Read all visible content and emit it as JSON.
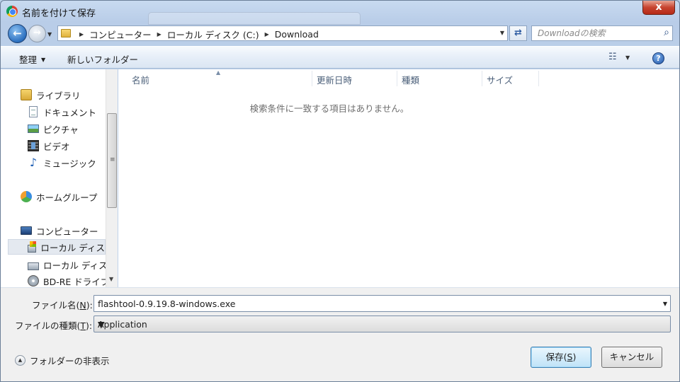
{
  "window": {
    "title": "名前を付けて保存",
    "close_label": "x"
  },
  "nav": {
    "back_label": "←",
    "forward_label": "→"
  },
  "address": {
    "crumbs": [
      "コンピューター",
      "ローカル ディスク (C:)",
      "Download"
    ]
  },
  "search": {
    "placeholder": "Downloadの検索"
  },
  "toolbar": {
    "organize_label": "整理",
    "new_folder_label": "新しいフォルダー",
    "help_label": "?"
  },
  "sidebar": {
    "items": [
      {
        "label": "ライブラリ",
        "icon": "library-icon"
      },
      {
        "label": "ドキュメント",
        "icon": "documents-icon"
      },
      {
        "label": "ピクチャ",
        "icon": "pictures-icon"
      },
      {
        "label": "ビデオ",
        "icon": "videos-icon"
      },
      {
        "label": "ミュージック",
        "icon": "music-icon"
      },
      {
        "label": "ホームグループ",
        "icon": "homegroup-icon"
      },
      {
        "label": "コンピューター",
        "icon": "computer-icon"
      },
      {
        "label": "ローカル ディス",
        "icon": "local-disk-icon",
        "selected": true
      },
      {
        "label": "ローカル ディス",
        "icon": "local-disk-icon"
      },
      {
        "label": "BD-RE ドライブ",
        "icon": "bd-drive-icon"
      }
    ]
  },
  "file_list": {
    "columns": [
      "名前",
      "更新日時",
      "種類",
      "サイズ"
    ],
    "empty_message": "検索条件に一致する項目はありません。"
  },
  "form": {
    "filename_label": "ファイル名(",
    "filename_key": "N",
    "filename_label_end": "):",
    "filename_value": "flashtool-0.9.19.8-windows.exe",
    "filetype_label": "ファイルの種類(",
    "filetype_key": "T",
    "filetype_label_end": "):",
    "filetype_value": "Application"
  },
  "footer": {
    "hide_folders_label": "フォルダーの非表示",
    "save_label": "保存(",
    "save_key": "S",
    "save_label_end": ")",
    "cancel_label": "キャンセル"
  },
  "colors": {
    "accent": "#3c7fb1",
    "titlebar": "#c8daf0",
    "close_button": "#c7432f"
  }
}
